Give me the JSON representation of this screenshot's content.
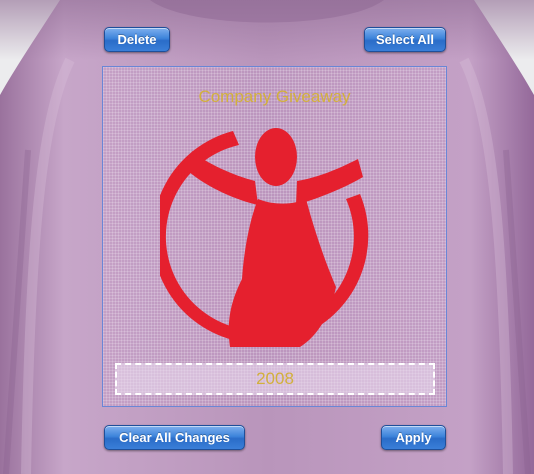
{
  "toolbar": {
    "delete_label": "Delete",
    "select_all_label": "Select All",
    "clear_all_label": "Clear All Changes",
    "apply_label": "Apply"
  },
  "design": {
    "top_text": "Company Giveaway",
    "year_text": "2008",
    "logo_icon": "save-the-children-logo-icon",
    "shirt_color": "#b58fb8",
    "logo_color": "#e5202e",
    "text_color": "#d2b03c"
  }
}
